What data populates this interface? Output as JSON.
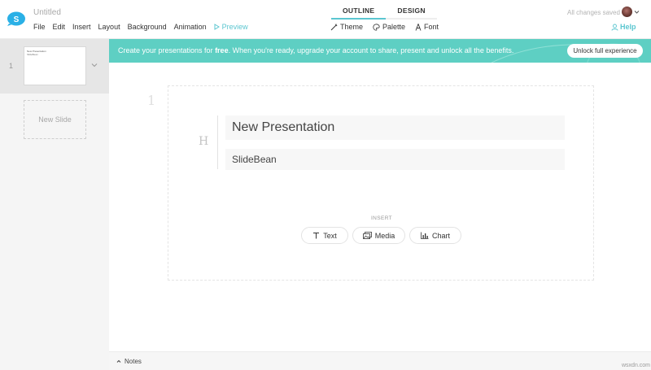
{
  "app": {
    "doc_title": "Untitled",
    "save_status": "All changes saved"
  },
  "menu": {
    "items": [
      "File",
      "Edit",
      "Insert",
      "Layout",
      "Background",
      "Animation"
    ],
    "preview": "Preview"
  },
  "modes": {
    "outline": "OUTLINE",
    "design": "DESIGN"
  },
  "tools": {
    "theme": "Theme",
    "palette": "Palette",
    "font": "Font"
  },
  "help": "Help",
  "banner": {
    "text_before": "Create your presentations for ",
    "text_bold": "free",
    "text_after": ". When you're ready, upgrade your account to share, present and unlock all the benefits.",
    "button": "Unlock full experience"
  },
  "sidebar": {
    "slide_number": "1",
    "thumb_title": "New Presentation",
    "thumb_subtitle": "SlideBean",
    "new_slide": "New Slide"
  },
  "editor": {
    "slide_number": "1",
    "heading_marker": "H",
    "title": "New Presentation",
    "subtitle": "SlideBean",
    "insert_label": "INSERT",
    "insert_buttons": {
      "text": "Text",
      "media": "Media",
      "chart": "Chart"
    }
  },
  "notes": {
    "label": "Notes"
  },
  "watermark": "wsxdn.com",
  "colors": {
    "accent": "#5bc6d0",
    "banner": "#5ecfc3",
    "logo": "#2ab0e6"
  }
}
